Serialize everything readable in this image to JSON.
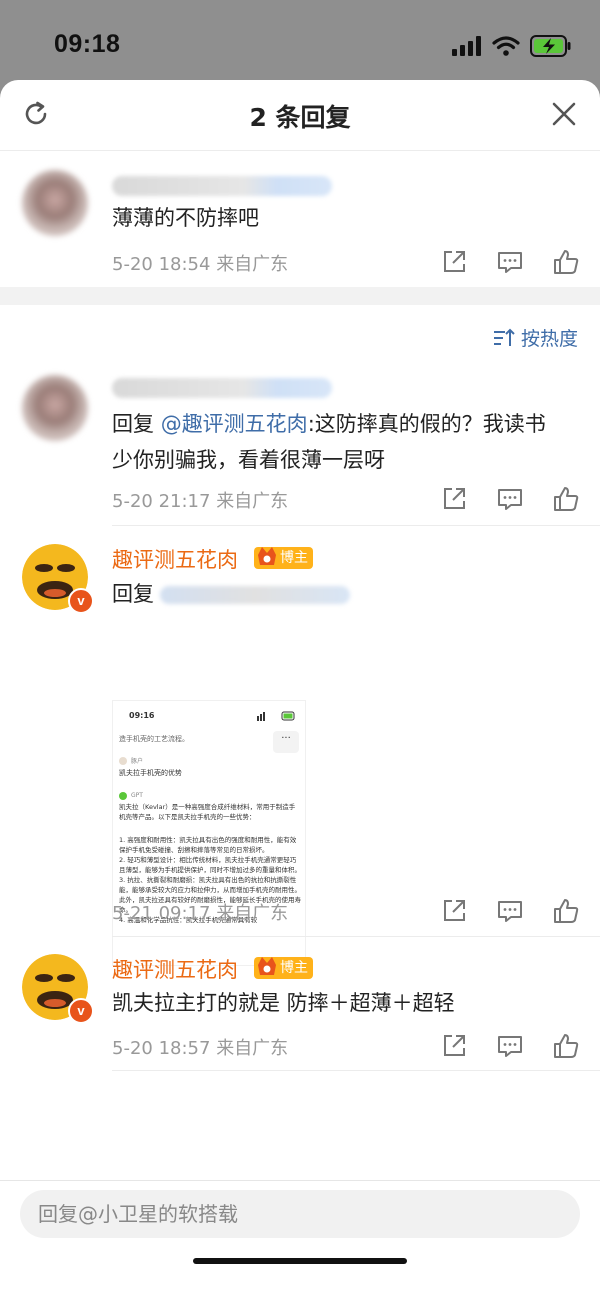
{
  "status_bar": {
    "time": "09:18"
  },
  "header": {
    "title": "2 条回复"
  },
  "op_comment": {
    "text": "薄薄的不防摔吧",
    "date": "5-20 18:54",
    "source": "来自广东"
  },
  "sort": {
    "label": "按热度"
  },
  "replies": [
    {
      "prefix": "回复",
      "mention": "@趣评测五花肉",
      "text": ":这防摔真的假的？我读书少你别骗我，看着很薄一层呀",
      "line1": ":这防摔真的假的？我读书",
      "line2": "少你别骗我，看着很薄一层呀",
      "date": "5-20 21:17",
      "source": "来自广东"
    },
    {
      "username": "趣评测五花肉",
      "badge": "博主",
      "prefix": "回复",
      "date": "5-21 09:17",
      "source": "来自广东",
      "embedded_screenshot": {
        "time": "09:16",
        "top_text": "造手机壳的工艺流程。",
        "user_label": "豚户",
        "question": "凯夫拉手机壳的优势",
        "gpt_label": "GPT",
        "intro": "凯夫拉（Kevlar）是一种高强度合成纤维材料，常用于制造手机壳等产品。以下是凯夫拉手机壳的一些优势：",
        "points": [
          "1. 高强度和耐用性：凯夫拉具有出色的强度和耐用性，能有效保护手机免受碰撞、刮擦和摔落等常见的日常损坏。",
          "2. 轻巧和薄型设计：相比传统材料，凯夫拉手机壳通常更轻巧且薄型，能够为手机提供保护，同时不增加过多的重量和体积。",
          "3. 抗拉、抗撕裂和耐磨损：凯夫拉具有出色的抗拉和抗撕裂性能，能够承受较大的应力和拉伸力，从而增加手机壳的耐用性。此外，凯夫拉还具有较好的耐磨损性，能够延长手机壳的使用寿命。",
          "4. 高温和化学品抗性：凯夫拉手机壳通常具有较"
        ]
      }
    },
    {
      "username": "趣评测五花肉",
      "badge": "博主",
      "text": "凯夫拉主打的就是 防摔＋超薄＋超轻",
      "date": "5-20 18:57",
      "source": "来自广东"
    }
  ],
  "reply_input": {
    "placeholder": "回复@小卫星的软搭载"
  },
  "colors": {
    "username_orange": "#eb6a14",
    "mention_blue": "#3f6da8",
    "badge_gold": "#ffb21a",
    "meta_gray": "#999999"
  }
}
